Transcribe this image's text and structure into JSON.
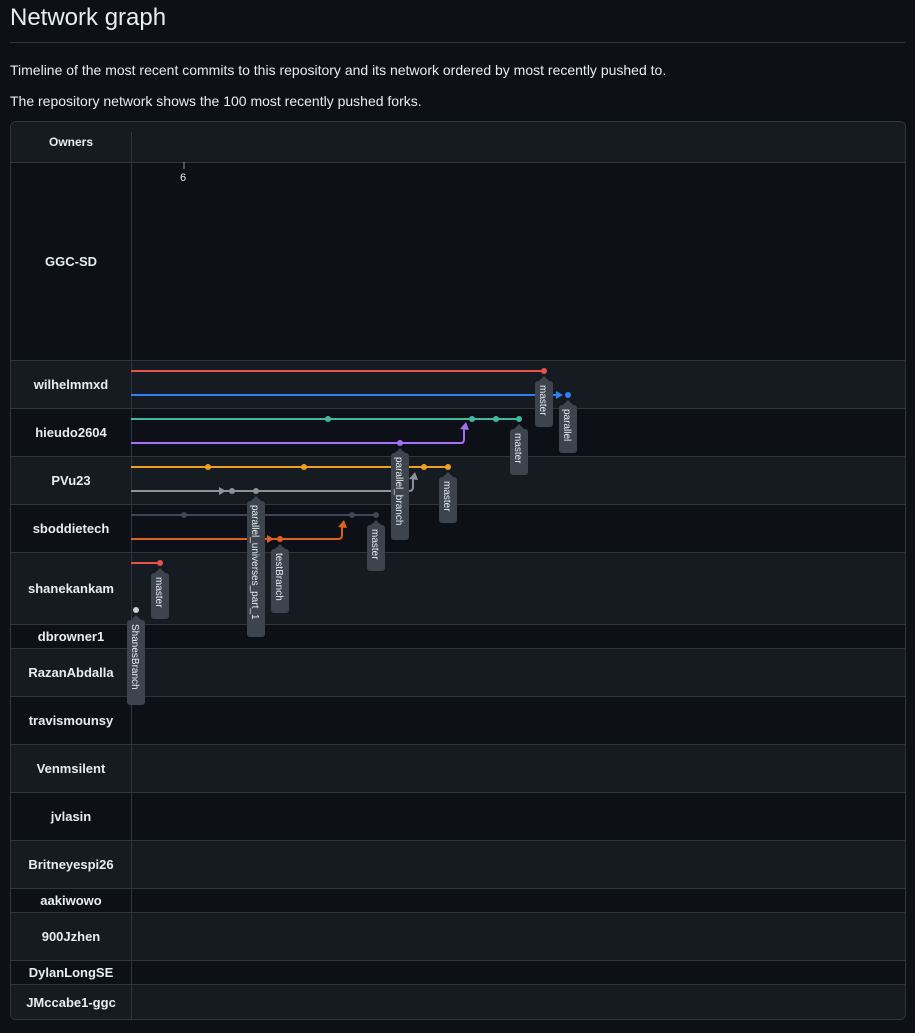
{
  "page": {
    "title": "Network graph",
    "description_1": "Timeline of the most recent commits to this repository and its network ordered by most recently pushed to.",
    "description_2": "The repository network shows the 100 most recently pushed forks."
  },
  "graph": {
    "owners_header": "Owners",
    "date_tick": "6",
    "owners": [
      "GGC-SD",
      "wilhelmmxd",
      "hieudo2604",
      "PVu23",
      "sboddietech",
      "shanekankam",
      "dbrowner1",
      "RazanAbdalla",
      "travismounsy",
      "Venmsilent",
      "jvlasin",
      "Britneyespi26",
      "aakiwowo",
      "900Jzhen",
      "DylanLongSE",
      "JMccabe1-ggc"
    ],
    "branch_labels": [
      "master",
      "parallel",
      "master",
      "parallel_branch",
      "master",
      "parallel_universes_part_1",
      "master",
      "testBranch",
      "master",
      "ShanesBranch"
    ],
    "colors": {
      "red": "#e5534b",
      "blue": "#2f81f7",
      "teal": "#3fb9a0",
      "purple": "#a371f7",
      "orange": "#f0a020",
      "gray": "#8b949e",
      "slate": "#3d4754",
      "darkorange": "#e0601f",
      "white": "#c9d1d9"
    }
  }
}
